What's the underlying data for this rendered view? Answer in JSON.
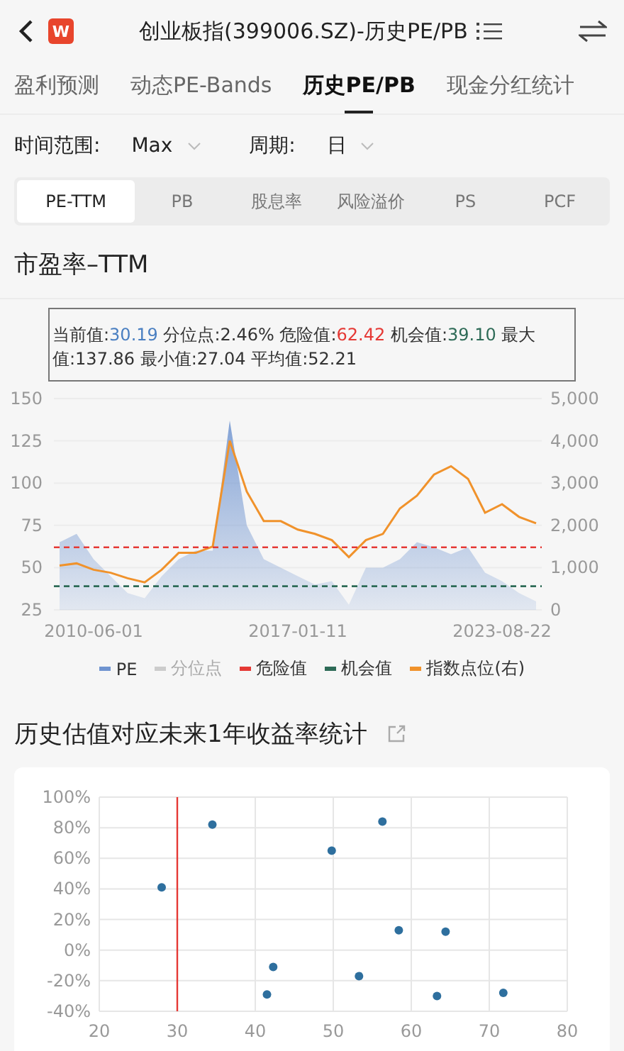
{
  "header": {
    "logo": "W",
    "title": "创业板指(399006.SZ)-历史PE/PB"
  },
  "tabs": [
    {
      "label": "盈利预测",
      "selected": false
    },
    {
      "label": "动态PE-Bands",
      "selected": false
    },
    {
      "label": "历史PE/PB",
      "selected": true
    },
    {
      "label": "现金分红统计",
      "selected": false
    }
  ],
  "filters": [
    {
      "label": "时间范围:",
      "value": "Max"
    },
    {
      "label": "周期:",
      "value": "日"
    }
  ],
  "metrics": [
    {
      "label": "PE-TTM",
      "selected": true
    },
    {
      "label": "PB",
      "selected": false
    },
    {
      "label": "股息率",
      "selected": false
    },
    {
      "label": "风险溢价",
      "selected": false
    },
    {
      "label": "PS",
      "selected": false
    },
    {
      "label": "PCF",
      "selected": false
    }
  ],
  "main": {
    "title": "市盈率–TTM",
    "stats": [
      {
        "label": "当前值:",
        "value": "30.19",
        "kind": "current"
      },
      {
        "label": "分位点:",
        "value": "2.46%",
        "kind": "plain"
      },
      {
        "label": "危险值:",
        "value": "62.42",
        "kind": "danger"
      },
      {
        "label": "机会值:",
        "value": "39.10",
        "kind": "chance"
      },
      {
        "label": "最大值:",
        "value": "137.86",
        "kind": "plain"
      },
      {
        "label": "最小值:",
        "value": "27.04",
        "kind": "plain"
      },
      {
        "label": "平均值:",
        "value": "52.21",
        "kind": "plain"
      }
    ],
    "chart_data": {
      "type": "area",
      "grid": true,
      "categories": [
        null,
        null,
        "2010-06-01",
        null,
        null,
        null,
        null,
        null,
        null,
        null,
        null,
        null,
        null,
        null,
        "2017-01-11",
        null,
        null,
        null,
        null,
        null,
        null,
        null,
        null,
        null,
        null,
        null,
        "2023-08-22",
        null,
        null
      ],
      "ylim": [
        25,
        150
      ],
      "yticks": [
        25,
        50,
        75,
        100,
        125,
        150
      ],
      "y2lim": [
        0,
        5000
      ],
      "y2ticks": [
        {
          "value": 0,
          "label": "0"
        },
        {
          "value": 1000,
          "label": "1,000"
        },
        {
          "value": 2000,
          "label": "2,000"
        },
        {
          "value": 3000,
          "label": "3,000"
        },
        {
          "value": 4000,
          "label": "4,000"
        },
        {
          "value": 5000,
          "label": "5,000"
        }
      ],
      "series": [
        {
          "type": "area",
          "color": "#6f94d0",
          "values": [
            65,
            70,
            55,
            45,
            35,
            32,
            45,
            55,
            60,
            60,
            137,
            75,
            55,
            50,
            45,
            40,
            42,
            28,
            50,
            50,
            55,
            65,
            62,
            58,
            62,
            47,
            42,
            35,
            30
          ]
        },
        {
          "type": "line",
          "axis": "y2",
          "color": "#f0922b",
          "values": [
            1050,
            1100,
            950,
            880,
            750,
            650,
            950,
            1350,
            1350,
            1500,
            4000,
            2800,
            2100,
            2100,
            1900,
            1800,
            1650,
            1250,
            1650,
            1800,
            2400,
            2700,
            3200,
            3400,
            3100,
            2300,
            2500,
            2200,
            2050
          ]
        }
      ],
      "ref_lines": [
        {
          "axis": "y",
          "value": 62,
          "color": "#e53935"
        },
        {
          "axis": "y",
          "value": 39,
          "color": "#2e6b57"
        }
      ]
    },
    "legend": [
      {
        "label": "PE",
        "color": "#6f94d0",
        "enabled": true
      },
      {
        "label": "分位点",
        "color": "#cccccc",
        "enabled": false
      },
      {
        "label": "危险值",
        "color": "#e53935",
        "enabled": true
      },
      {
        "label": "机会值",
        "color": "#2e6b57",
        "enabled": true
      },
      {
        "label": "指数点位(右)",
        "color": "#f0922b",
        "enabled": true
      }
    ]
  },
  "returns": {
    "title": "历史估值对应未来1年收益率统计",
    "chart_data": {
      "type": "scatter",
      "xlim": [
        20,
        80
      ],
      "ylim": [
        -40,
        100
      ],
      "grid": true,
      "xticks": [
        20,
        30,
        40,
        50,
        60,
        70,
        80
      ],
      "yticks": [
        {
          "value": -40,
          "label": "-40%"
        },
        {
          "value": -20,
          "label": "-20%"
        },
        {
          "value": 0,
          "label": "0%"
        },
        {
          "value": 20,
          "label": "20%"
        },
        {
          "value": 40,
          "label": "40%"
        },
        {
          "value": 60,
          "label": "60%"
        },
        {
          "value": 80,
          "label": "80%"
        },
        {
          "value": 100,
          "label": "100%"
        }
      ],
      "x": [
        28,
        34.5,
        41.5,
        42.3,
        49.8,
        53.3,
        56.3,
        58.4,
        63.3,
        64.4,
        71.8
      ],
      "series": [
        {
          "color": "#2e6f9e",
          "values": [
            41,
            82,
            -29,
            -11,
            65,
            -17,
            84,
            13,
            -30,
            12,
            -28
          ]
        }
      ],
      "ref_lines": [
        {
          "axis": "x",
          "value": 30,
          "color": "#e53935"
        }
      ]
    }
  }
}
